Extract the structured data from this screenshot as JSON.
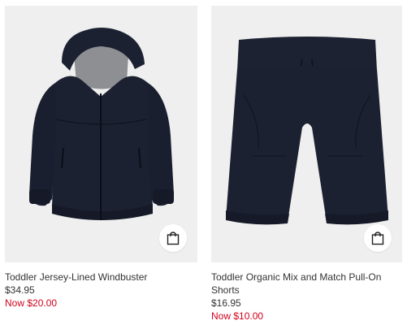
{
  "products": [
    {
      "title": "Toddler Jersey-Lined Windbuster",
      "price": "$34.95",
      "sale_price": "Now $20.00",
      "image_icon": "navy-windbreaker-jacket",
      "bag_icon": "shopping-bag-icon"
    },
    {
      "title": "Toddler Organic Mix and Match Pull-On Shorts",
      "price": "$16.95",
      "sale_price": "Now $10.00",
      "image_icon": "navy-pull-on-shorts",
      "bag_icon": "shopping-bag-icon"
    }
  ],
  "colors": {
    "tile_background": "#efefef",
    "garment_navy": "#1c2132",
    "sale_red": "#d0021b",
    "text": "#333333"
  }
}
